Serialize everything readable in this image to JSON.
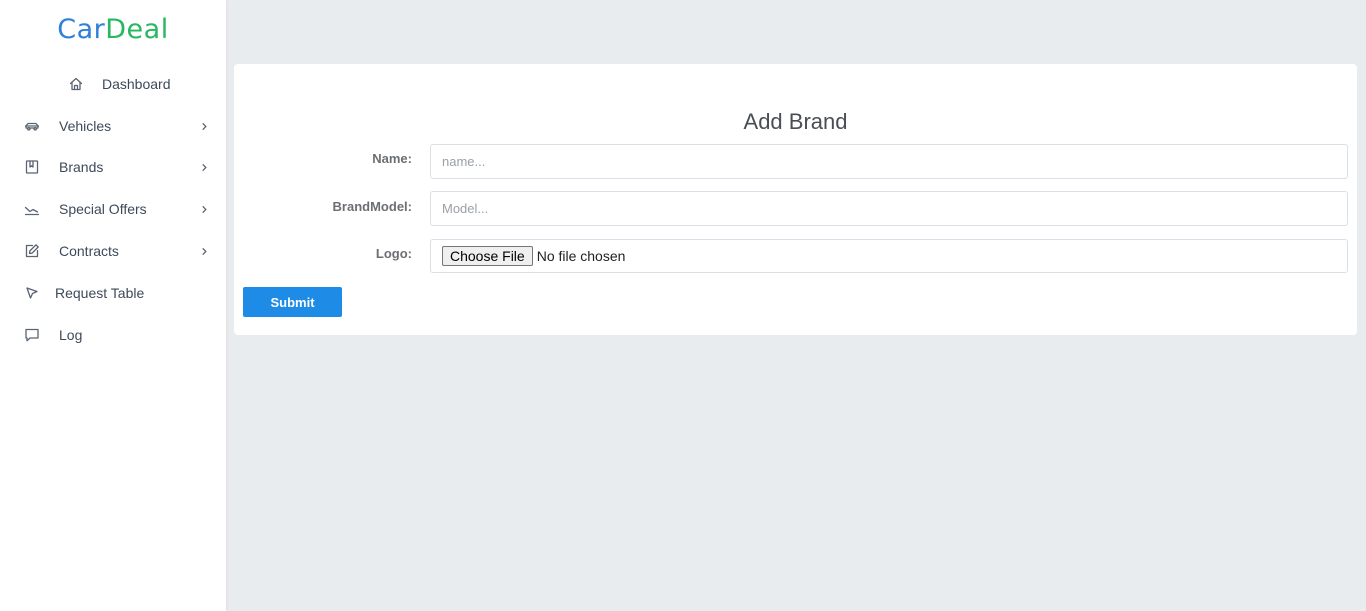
{
  "brand": {
    "part1": "Car",
    "part2": "Deal",
    "color1": "#2f80d8",
    "color2": "#27b861"
  },
  "sidebar": {
    "items": [
      {
        "label": "Dashboard",
        "icon": "home-icon"
      },
      {
        "label": "Vehicles",
        "icon": "car-icon",
        "expandable": true
      },
      {
        "label": "Brands",
        "icon": "bookmark-icon",
        "expandable": true
      },
      {
        "label": "Special Offers",
        "icon": "trending-down-icon",
        "expandable": true
      },
      {
        "label": "Contracts",
        "icon": "edit-icon",
        "expandable": true
      },
      {
        "label": "Request Table",
        "icon": "cursor-icon"
      },
      {
        "label": "Log",
        "icon": "message-icon"
      }
    ]
  },
  "form": {
    "title": "Add Brand",
    "name_label": "Name:",
    "name_placeholder": "name...",
    "model_label": "BrandModel:",
    "model_placeholder": "Model...",
    "logo_label": "Logo:",
    "file_button": "Choose File",
    "file_status": "No file chosen",
    "submit_label": "Submit"
  },
  "colors": {
    "accent": "#1e8ce6",
    "background": "#e9ecef"
  }
}
